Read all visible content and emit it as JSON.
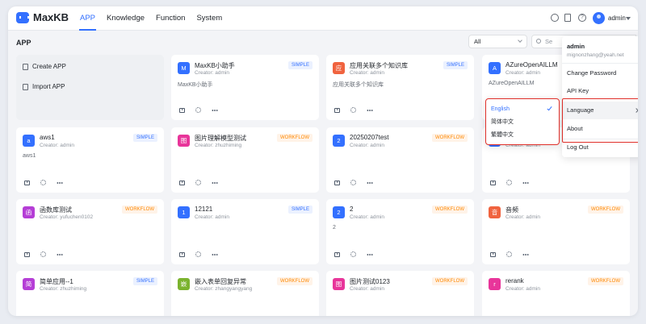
{
  "header": {
    "brand": "MaxKB",
    "nav": [
      "APP",
      "Knowledge",
      "Function",
      "System"
    ],
    "active_nav": "APP",
    "user": "admin"
  },
  "page": {
    "title": "APP",
    "filter_value": "All",
    "search_placeholder": "Se"
  },
  "create": {
    "create_label": "Create APP",
    "import_label": "Import APP"
  },
  "apps": [
    {
      "name": "MaxKB小助手",
      "creator": "Creator: admin",
      "type": "SIMPLE",
      "desc": "MaxKB小助手",
      "icon_text": "M",
      "icon_color": "#3370ff"
    },
    {
      "name": "应用关联多个知识库",
      "creator": "Creator: admin",
      "type": "SIMPLE",
      "desc": "应用关联多个知识库",
      "icon_text": "应",
      "icon_color": "#f0633f"
    },
    {
      "name": "AZureOpenAILLM",
      "creator": "Creator: admin",
      "type": "",
      "desc": "AZureOpenAILLM",
      "icon_text": "A",
      "icon_color": "#3370ff"
    },
    {
      "name": "aws1",
      "creator": "Creator: admin",
      "type": "SIMPLE",
      "desc": "aws1",
      "icon_text": "a",
      "icon_color": "#3370ff"
    },
    {
      "name": "图片理解模型测试",
      "creator": "Creator: zhuzhiming",
      "type": "WORKFLOW",
      "desc": "",
      "icon_text": "图",
      "icon_color": "#e8359a"
    },
    {
      "name": "20250207test",
      "creator": "Creator: admin",
      "type": "WORKFLOW",
      "desc": "",
      "icon_text": "2",
      "icon_color": "#3370ff"
    },
    {
      "name": "",
      "creator": "Creator: admin",
      "type": "",
      "desc": "",
      "icon_text": "a",
      "icon_color": "#3370ff"
    },
    {
      "name": "函数库测试",
      "creator": "Creator: yufuchen0102",
      "type": "WORKFLOW",
      "desc": "",
      "icon_text": "函",
      "icon_color": "#b53ed6"
    },
    {
      "name": "12121",
      "creator": "Creator: admin",
      "type": "SIMPLE",
      "desc": "",
      "icon_text": "1",
      "icon_color": "#3370ff"
    },
    {
      "name": "2",
      "creator": "Creator: admin",
      "type": "WORKFLOW",
      "desc": "2",
      "icon_text": "2",
      "icon_color": "#3370ff"
    },
    {
      "name": "音频",
      "creator": "Creator: admin",
      "type": "WORKFLOW",
      "desc": "",
      "icon_text": "音",
      "icon_color": "#f0633f"
    },
    {
      "name": "简单应用--1",
      "creator": "Creator: zhuzhiming",
      "type": "SIMPLE",
      "desc": "",
      "icon_text": "简",
      "icon_color": "#b53ed6"
    },
    {
      "name": "嵌入表单回复异常",
      "creator": "Creator: zhangyangyang",
      "type": "WORKFLOW",
      "desc": "",
      "icon_text": "嵌",
      "icon_color": "#7bb32e"
    },
    {
      "name": "图片测试0123",
      "creator": "Creator: admin",
      "type": "WORKFLOW",
      "desc": "",
      "icon_text": "图",
      "icon_color": "#e8359a"
    },
    {
      "name": "rerank",
      "creator": "Creator: admin",
      "type": "WORKFLOW",
      "desc": "",
      "icon_text": "r",
      "icon_color": "#e8359a"
    }
  ],
  "user_menu": {
    "name": "admin",
    "email": "mignonzhang@yeah.net",
    "items": [
      "Change Password",
      "API Key",
      "Language",
      "About",
      "Log Out"
    ]
  },
  "language_menu": {
    "options": [
      "English",
      "简体中文",
      "繁體中文"
    ],
    "selected": "English"
  },
  "colors": {
    "accent": "#3370ff",
    "workflow_badge": "#ff8800",
    "highlight_border": "#e0302a"
  }
}
